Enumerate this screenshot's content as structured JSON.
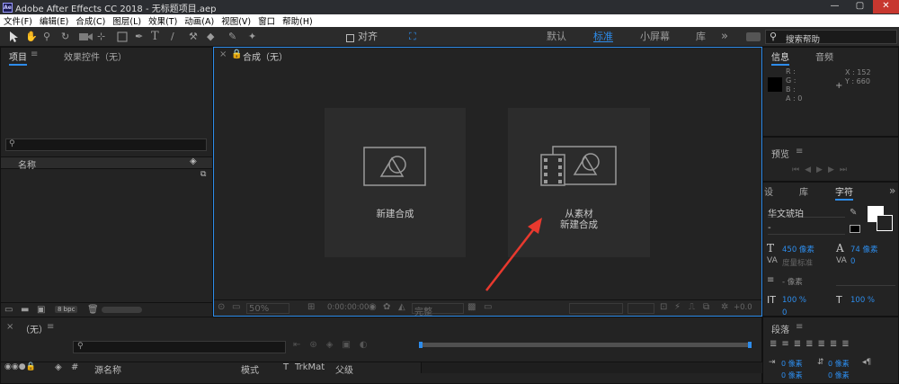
{
  "title": "Adobe After Effects CC 2018 - 无标题项目.aep",
  "app_icon": "Ae",
  "window_controls": {
    "minimize": "—",
    "restore": "▢",
    "close": "✕"
  },
  "menu": [
    "文件(F)",
    "编辑(E)",
    "合成(C)",
    "图层(L)",
    "效果(T)",
    "动画(A)",
    "视图(V)",
    "窗口",
    "帮助(H)"
  ],
  "toolbar": {
    "align_label": "对齐",
    "workspaces": [
      "默认",
      "标准",
      "小屏幕",
      "库"
    ],
    "active_workspace": "标准",
    "more": "»",
    "search_placeholder": "搜索帮助"
  },
  "project_panel": {
    "tabs": [
      "项目",
      "效果控件（无）"
    ],
    "col_name": "名称",
    "bpc": "8 bpc"
  },
  "comp_panel": {
    "tab": "合成（无）",
    "new_comp": "新建合成",
    "from_footage_line1": "从素材",
    "from_footage_line2": "新建合成",
    "zoom": "50%",
    "timecode": "0:00:00:00",
    "quality": "完整",
    "exposure": "+0.0"
  },
  "info_panel": {
    "tabs": [
      "信息",
      "音频"
    ],
    "r": "R :",
    "g": "G :",
    "b": "B :",
    "a": "A : 0",
    "x": "X : 152",
    "y": "Y : 660"
  },
  "preview_panel": {
    "tab": "预览"
  },
  "char_panel": {
    "tabs": [
      "设",
      "库",
      "字符"
    ],
    "font": "华文琥珀",
    "style": "-",
    "size": "450 像素",
    "leading": "74 像素",
    "kerning": "度量标准",
    "tracking": "0",
    "stroke": "- 像素",
    "vscale": "100 %",
    "hscale": "100 %"
  },
  "paragraph_panel": {
    "tab": "段落",
    "zero": "0 像素"
  },
  "timeline_panel": {
    "tab": "（无）",
    "columns": [
      "#",
      "源名称",
      "模式",
      "T",
      "TrkMat",
      "父级"
    ]
  },
  "colors": {
    "accent": "#2d8ceb",
    "arrow": "#e8392e"
  }
}
